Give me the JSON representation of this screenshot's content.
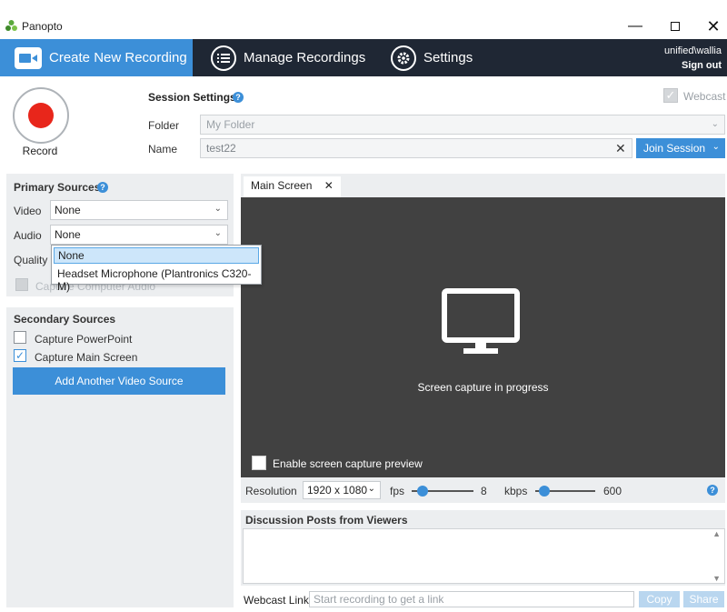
{
  "window": {
    "title": "Panopto"
  },
  "nav": {
    "tabs": [
      {
        "label": "Create New Recording",
        "icon": "camera-icon"
      },
      {
        "label": "Manage Recordings",
        "icon": "list-icon"
      },
      {
        "label": "Settings",
        "icon": "gear-icon"
      }
    ],
    "user": "unified\\wallia",
    "sign_out": "Sign out"
  },
  "record": {
    "label": "Record"
  },
  "session": {
    "title": "Session Settings",
    "webcast_label": "Webcast",
    "folder_label": "Folder",
    "folder_value": "My Folder",
    "name_label": "Name",
    "name_value": "test22",
    "join_label": "Join Session"
  },
  "primary": {
    "title": "Primary Sources",
    "video_label": "Video",
    "video_value": "None",
    "audio_label": "Audio",
    "audio_value": "None",
    "quality_label": "Quality",
    "capture_audio_label": "Capture Computer Audio",
    "audio_options": [
      "None",
      "Headset Microphone (Plantronics C320-M)"
    ]
  },
  "secondary": {
    "title": "Secondary Sources",
    "capture_ppt_label": "Capture PowerPoint",
    "capture_main_label": "Capture Main Screen",
    "add_source_label": "Add Another Video Source"
  },
  "preview": {
    "tab_label": "Main Screen",
    "status": "Screen capture in progress",
    "enable_preview_label": "Enable screen capture preview"
  },
  "controls": {
    "resolution_label": "Resolution",
    "resolution_value": "1920 x 1080",
    "fps_label": "fps",
    "fps_value": "8",
    "kbps_label": "kbps",
    "kbps_value": "600"
  },
  "discussion": {
    "title": "Discussion Posts from Viewers"
  },
  "webcast": {
    "link_label": "Webcast Link",
    "link_placeholder": "Start recording to get a link",
    "copy_label": "Copy",
    "share_label": "Share"
  },
  "colors": {
    "accent": "#3c8fd8",
    "navbar": "#1f2734",
    "record": "#e8261b",
    "preview_bg": "#414141"
  }
}
